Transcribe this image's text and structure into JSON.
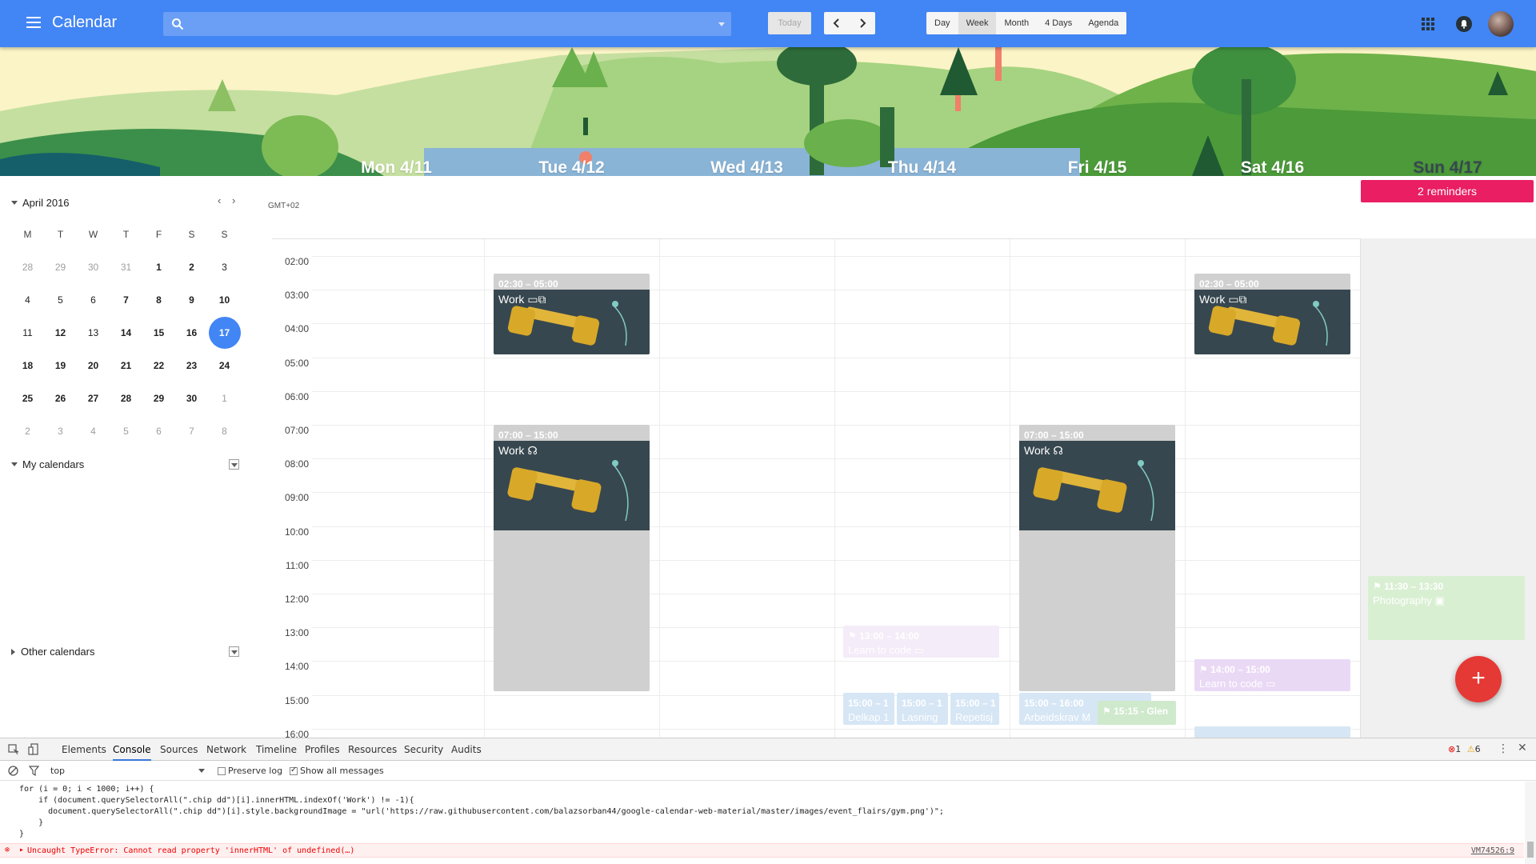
{
  "header": {
    "app_title": "Calendar",
    "search_placeholder": "",
    "today_label": "Today",
    "views": [
      "Day",
      "Week",
      "Month",
      "4 Days",
      "Agenda"
    ],
    "active_view": "Week"
  },
  "week": {
    "days": [
      "Mon 4/11",
      "Tue 4/12",
      "Wed 4/13",
      "Thu 4/14",
      "Fri 4/15",
      "Sat 4/16",
      "Sun 4/17"
    ],
    "reminders_label": "2 reminders",
    "timezone": "GMT+02",
    "hours": [
      "02:00",
      "03:00",
      "04:00",
      "05:00",
      "06:00",
      "07:00",
      "08:00",
      "09:00",
      "10:00",
      "11:00",
      "12:00",
      "13:00",
      "14:00",
      "15:00",
      "16:00"
    ]
  },
  "mini_calendar": {
    "month_label": "April 2016",
    "weekdays": [
      "M",
      "T",
      "W",
      "T",
      "F",
      "S",
      "S"
    ],
    "weeks": [
      [
        "28",
        "29",
        "30",
        "31",
        "1",
        "2",
        "3"
      ],
      [
        "4",
        "5",
        "6",
        "7",
        "8",
        "9",
        "10"
      ],
      [
        "11",
        "12",
        "13",
        "14",
        "15",
        "16",
        "17"
      ],
      [
        "18",
        "19",
        "20",
        "21",
        "22",
        "23",
        "24"
      ],
      [
        "25",
        "26",
        "27",
        "28",
        "29",
        "30",
        "1"
      ],
      [
        "2",
        "3",
        "4",
        "5",
        "6",
        "7",
        "8"
      ]
    ],
    "today": "17"
  },
  "sidebar": {
    "my_calendars": "My calendars",
    "other_calendars": "Other calendars"
  },
  "events": {
    "tue_early": {
      "time": "02:30 – 05:00",
      "title": "Work"
    },
    "sat_early": {
      "time": "02:30 – 05:00",
      "title": "Work"
    },
    "tue_work": {
      "time": "07:00 – 15:00",
      "title": "Work"
    },
    "fri_work": {
      "time": "07:00 – 15:00",
      "title": "Work"
    },
    "sun_photo": {
      "time": "11:30 – 13:30",
      "title": "Photography"
    },
    "thu_code": {
      "time": "13:00 – 14:00",
      "title": "Learn to code"
    },
    "sat_code": {
      "time": "14:00 – 15:00",
      "title": "Learn to code"
    },
    "thu_a": {
      "time": "15:00 – 1",
      "title": "Delkap 1"
    },
    "thu_b": {
      "time": "15:00 – 1",
      "title": "Lasning"
    },
    "thu_c": {
      "time": "15:00 – 1",
      "title": "Repetisj"
    },
    "fri_arb": {
      "time": "15:00 – 16:00",
      "title": "Arbeidskrav M"
    },
    "fri_glen": {
      "time": "15:15 - Glen"
    }
  },
  "fab_label": "+",
  "devtools": {
    "tabs": [
      "Elements",
      "Console",
      "Sources",
      "Network",
      "Timeline",
      "Profiles",
      "Resources",
      "Security",
      "Audits"
    ],
    "active_tab": "Console",
    "error_count": "1",
    "warning_count": "6",
    "context": "top",
    "preserve_log": "Preserve log",
    "show_all": "Show all messages",
    "code": [
      "for (i = 0; i < 1000; i++) {",
      "    if (document.querySelectorAll(\".chip dd\")[i].innerHTML.indexOf('Work') != -1){",
      "      document.querySelectorAll(\".chip dd\")[i].style.backgroundImage = \"url('https://raw.githubusercontent.com/balazsorban44/google-calendar-web-material/master/images/event_flairs/gym.png')\";",
      "    }",
      "}"
    ],
    "error_message": "Uncaught TypeError: Cannot read property 'innerHTML' of undefined(…)",
    "error_source": "VM74526:9"
  },
  "colors": {
    "primary": "#4285f4",
    "reminder": "#e91e63",
    "fab": "#e53935",
    "event_dark": "#37474f",
    "event_gray": "#d0d0d0"
  }
}
